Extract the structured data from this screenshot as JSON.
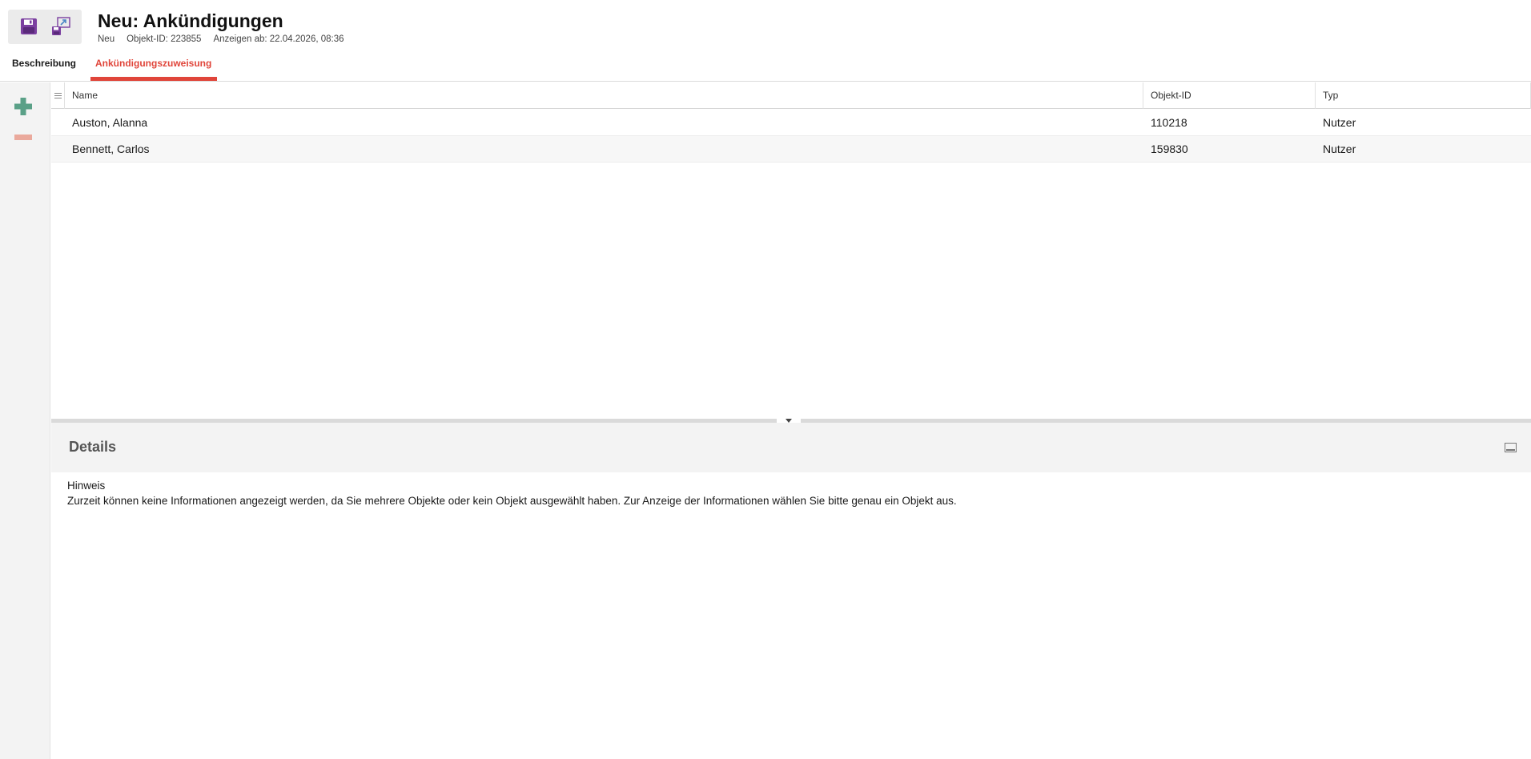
{
  "header": {
    "title": "Neu: Ankündigungen",
    "meta": {
      "state": "Neu",
      "object_id": "Objekt-ID: 223855",
      "show_from": "Anzeigen ab: 22.04.2026, 08:36"
    }
  },
  "toolbar": {
    "icons": [
      "save-icon",
      "save-and-close-icon"
    ]
  },
  "tabs": [
    {
      "label": "Beschreibung",
      "active": false
    },
    {
      "label": "Ankündigungszuweisung",
      "active": true
    }
  ],
  "actions": {
    "icons": [
      "plus-icon",
      "minus-icon"
    ],
    "add_color": "#5aa087",
    "remove_color": "#eaa99c"
  },
  "grid": {
    "columns": [
      "Name",
      "Objekt-ID",
      "Typ"
    ],
    "rows": [
      {
        "name": "Auston, Alanna",
        "id": "110218",
        "type": "Nutzer"
      },
      {
        "name": "Bennett, Carlos",
        "id": "159830",
        "type": "Nutzer"
      }
    ]
  },
  "details": {
    "title": "Details",
    "hint_label": "Hinweis",
    "hint_text": "Zurzeit können keine Informationen angezeigt werden, da Sie mehrere Objekte oder kein Objekt ausgewählt haben. Zur Anzeige der Informationen wählen Sie bitte genau ein Objekt aus."
  },
  "colors": {
    "accent": "#e0453a",
    "icon_purple": "#7b3fa0"
  }
}
